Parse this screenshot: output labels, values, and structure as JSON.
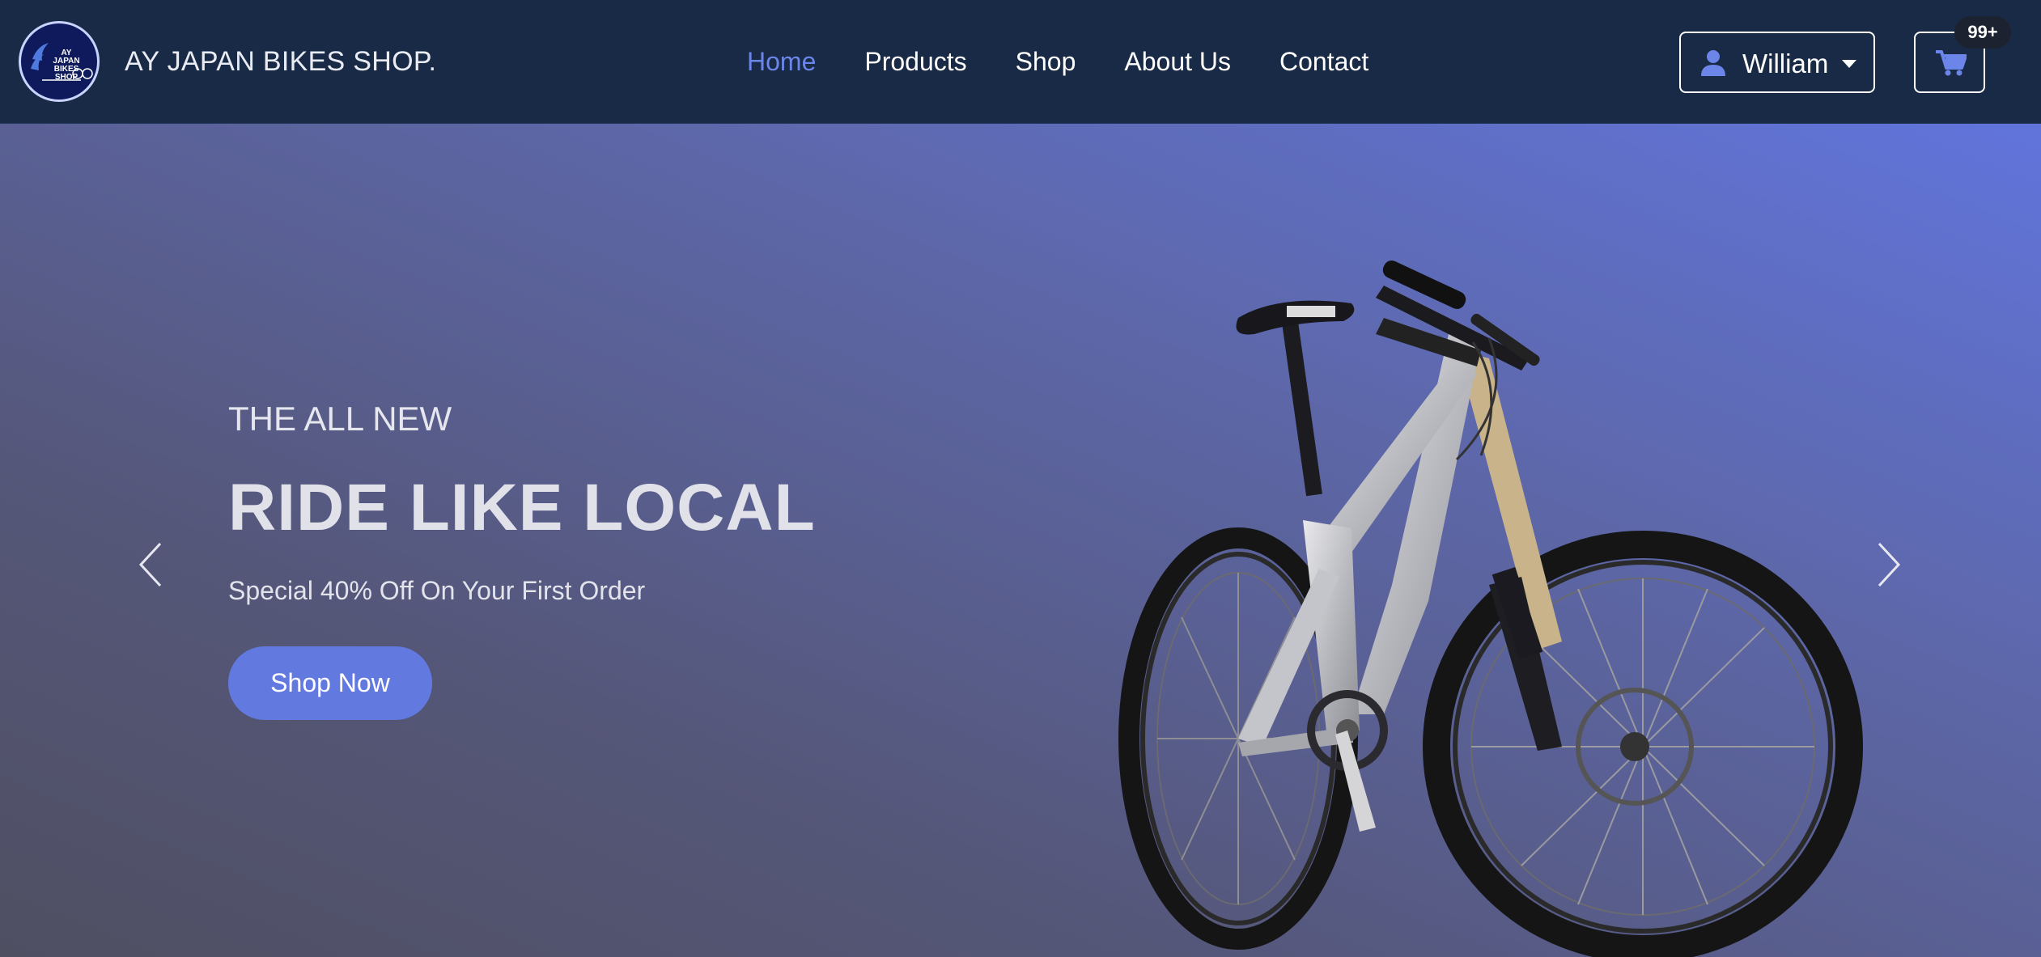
{
  "brand": {
    "logo_text": "AY JAPAN\nBIKES\nSHOP",
    "name": "AY JAPAN BIKES SHOP."
  },
  "nav": {
    "items": [
      {
        "label": "Home",
        "active": true
      },
      {
        "label": "Products",
        "active": false
      },
      {
        "label": "Shop",
        "active": false
      },
      {
        "label": "About Us",
        "active": false
      },
      {
        "label": "Contact",
        "active": false
      }
    ]
  },
  "user_menu": {
    "name": "William",
    "icon": "user-icon"
  },
  "cart": {
    "icon": "cart-icon",
    "badge": "99+"
  },
  "hero": {
    "kicker": "THE ALL NEW",
    "title": "RIDE LIKE LOCAL",
    "subtitle": "Special 40% Off On Your First Order",
    "cta_label": "Shop Now",
    "image": "mountain-bike-image"
  },
  "colors": {
    "navbar_bg": "#182a45",
    "accent": "#6279e0",
    "active_link": "#6b85e8",
    "badge_bg": "#1c2230"
  }
}
